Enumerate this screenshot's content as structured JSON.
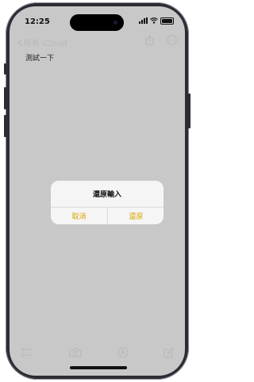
{
  "status": {
    "time": "12:25"
  },
  "nav": {
    "back_label": "所有 iCloud"
  },
  "note": {
    "title": "測試一下"
  },
  "dialog": {
    "title": "還原輸入",
    "cancel_label": "取消",
    "confirm_label": "還原"
  },
  "toolbar": {
    "icons": [
      "checklist-icon",
      "camera-icon",
      "markup-icon",
      "compose-icon"
    ]
  },
  "colors": {
    "accent": "#d9a400",
    "overlay": "#c8c8c8",
    "dialog_bg": "#f5f5f5"
  }
}
